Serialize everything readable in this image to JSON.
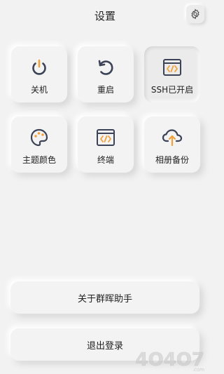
{
  "header": {
    "title": "设置",
    "settings_icon": "gear-icon"
  },
  "grid": {
    "tiles": [
      {
        "label": "关机",
        "icon": "power-icon"
      },
      {
        "label": "重启",
        "icon": "restart-icon"
      },
      {
        "label": "SSH已开启",
        "icon": "code-window-icon",
        "active": true
      },
      {
        "label": "主题颜色",
        "icon": "palette-icon"
      },
      {
        "label": "终端",
        "icon": "terminal-icon"
      },
      {
        "label": "相册备份",
        "icon": "cloud-upload-icon"
      }
    ]
  },
  "bottom": {
    "about_label": "关于群晖助手",
    "logout_label": "退出登录"
  },
  "colors": {
    "icon_dark": "#3d4356",
    "accent_orange": "#f0a23c",
    "background": "#f2f2f2"
  },
  "watermark": {
    "text": "4O4O7.com"
  }
}
